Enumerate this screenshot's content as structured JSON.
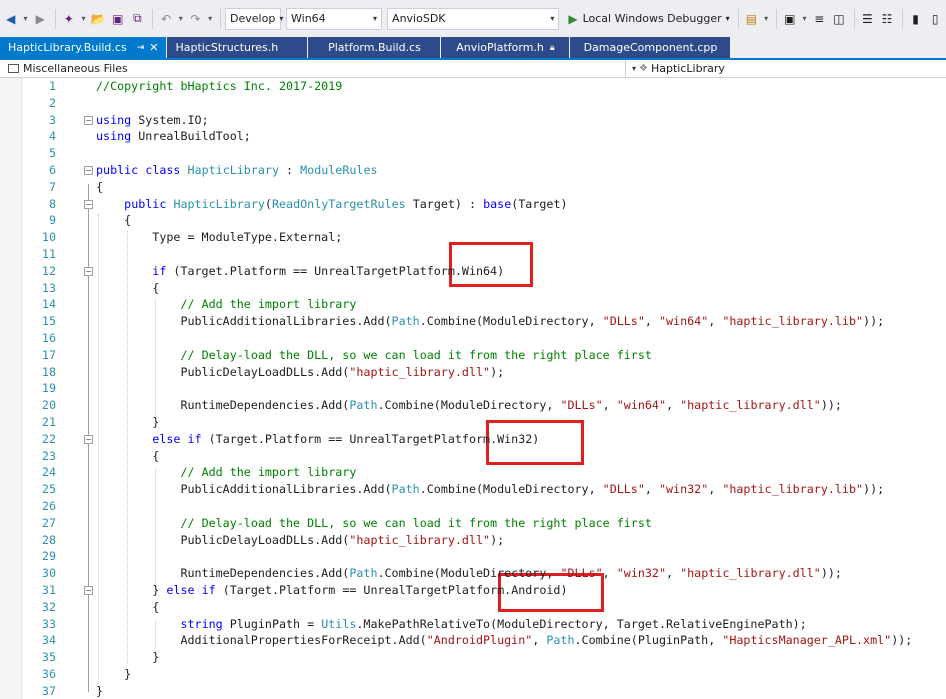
{
  "toolbar": {
    "config": "Develop",
    "platform": "Win64",
    "project": "AnvioSDK",
    "debugger": "Local Windows Debugger"
  },
  "tabs": [
    {
      "label": "HapticLibrary.Build.cs",
      "active": true
    },
    {
      "label": "HapticStructures.h"
    },
    {
      "label": "Platform.Build.cs"
    },
    {
      "label": "AnvioPlatform.h"
    },
    {
      "label": "DamageComponent.cpp"
    }
  ],
  "navbar": {
    "project_scope": "Miscellaneous Files",
    "type_scope": "HapticLibrary"
  },
  "colors": {
    "keyword": "#0000ff",
    "type": "#2b91af",
    "string": "#a31515",
    "comment": "#008000",
    "highlight_box": "#e02020",
    "tab_active": "#007acc"
  },
  "code_lines": [
    {
      "n": "1",
      "text": "//Copyright bHaptics Inc. 2017-2019"
    },
    {
      "n": "2",
      "text": ""
    },
    {
      "n": "3",
      "text": "using System.IO;"
    },
    {
      "n": "4",
      "text": "using UnrealBuildTool;"
    },
    {
      "n": "5",
      "text": ""
    },
    {
      "n": "6",
      "text": "public class HapticLibrary : ModuleRules"
    },
    {
      "n": "7",
      "text": "{"
    },
    {
      "n": "8",
      "text": "    public HapticLibrary(ReadOnlyTargetRules Target) : base(Target)"
    },
    {
      "n": "9",
      "text": "    {"
    },
    {
      "n": "10",
      "text": "        Type = ModuleType.External;"
    },
    {
      "n": "11",
      "text": ""
    },
    {
      "n": "12",
      "text": "        if (Target.Platform == UnrealTargetPlatform.Win64)"
    },
    {
      "n": "13",
      "text": "        {"
    },
    {
      "n": "14",
      "text": "            // Add the import library"
    },
    {
      "n": "15",
      "text": "            PublicAdditionalLibraries.Add(Path.Combine(ModuleDirectory, \"DLLs\", \"win64\", \"haptic_library.lib\"));"
    },
    {
      "n": "16",
      "text": ""
    },
    {
      "n": "17",
      "text": "            // Delay-load the DLL, so we can load it from the right place first"
    },
    {
      "n": "18",
      "text": "            PublicDelayLoadDLLs.Add(\"haptic_library.dll\");"
    },
    {
      "n": "19",
      "text": ""
    },
    {
      "n": "20",
      "text": "            RuntimeDependencies.Add(Path.Combine(ModuleDirectory, \"DLLs\", \"win64\", \"haptic_library.dll\"));"
    },
    {
      "n": "21",
      "text": "        }"
    },
    {
      "n": "22",
      "text": "        else if (Target.Platform == UnrealTargetPlatform.Win32)"
    },
    {
      "n": "23",
      "text": "        {"
    },
    {
      "n": "24",
      "text": "            // Add the import library"
    },
    {
      "n": "25",
      "text": "            PublicAdditionalLibraries.Add(Path.Combine(ModuleDirectory, \"DLLs\", \"win32\", \"haptic_library.lib\"));"
    },
    {
      "n": "26",
      "text": ""
    },
    {
      "n": "27",
      "text": "            // Delay-load the DLL, so we can load it from the right place first"
    },
    {
      "n": "28",
      "text": "            PublicDelayLoadDLLs.Add(\"haptic_library.dll\");"
    },
    {
      "n": "29",
      "text": ""
    },
    {
      "n": "30",
      "text": "            RuntimeDependencies.Add(Path.Combine(ModuleDirectory, \"DLLs\", \"win32\", \"haptic_library.dll\"));"
    },
    {
      "n": "31",
      "text": "        } else if (Target.Platform == UnrealTargetPlatform.Android)"
    },
    {
      "n": "32",
      "text": "        {"
    },
    {
      "n": "33",
      "text": "            string PluginPath = Utils.MakePathRelativeTo(ModuleDirectory, Target.RelativeEnginePath);"
    },
    {
      "n": "34",
      "text": "            AdditionalPropertiesForReceipt.Add(\"AndroidPlugin\", Path.Combine(PluginPath, \"HapticsManager_APL.xml\"));"
    },
    {
      "n": "35",
      "text": "        }"
    },
    {
      "n": "36",
      "text": "    }"
    },
    {
      "n": "37",
      "text": "}"
    }
  ]
}
